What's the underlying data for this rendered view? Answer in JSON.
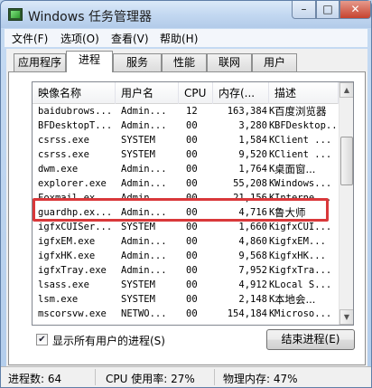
{
  "window": {
    "title": "Windows 任务管理器",
    "controls": {
      "minimize": "–",
      "maximize": "□",
      "close": "✕"
    }
  },
  "menu": [
    "文件(F)",
    "选项(O)",
    "查看(V)",
    "帮助(H)"
  ],
  "tabs": [
    "应用程序",
    "进程",
    "服务",
    "性能",
    "联网",
    "用户"
  ],
  "active_tab": "进程",
  "columns": [
    "映像名称",
    "用户名",
    "CPU",
    "内存(...",
    "描述"
  ],
  "processes": [
    {
      "name": "baidubrows...",
      "user": "Admin...",
      "cpu": "12",
      "mem": "163,384",
      "unit": "K",
      "desc": "百度浏览器"
    },
    {
      "name": "BFDesktopT...",
      "user": "Admin...",
      "cpu": "00",
      "mem": "3,280",
      "unit": "K",
      "desc": "BFDesktop..."
    },
    {
      "name": "csrss.exe",
      "user": "SYSTEM",
      "cpu": "00",
      "mem": "1,584",
      "unit": "K",
      "desc": "Client ..."
    },
    {
      "name": "csrss.exe",
      "user": "SYSTEM",
      "cpu": "00",
      "mem": "9,520",
      "unit": "K",
      "desc": "Client ..."
    },
    {
      "name": "dwm.exe",
      "user": "Admin...",
      "cpu": "00",
      "mem": "1,764",
      "unit": "K",
      "desc": "桌面窗..."
    },
    {
      "name": "explorer.exe",
      "user": "Admin...",
      "cpu": "00",
      "mem": "55,208",
      "unit": "K",
      "desc": "Windows..."
    },
    {
      "name": "Foxmail.ex...",
      "user": "Admin...",
      "cpu": "00",
      "mem": "21,156",
      "unit": "K",
      "desc": "Interne..."
    },
    {
      "name": "guardhp.ex...",
      "user": "Admin...",
      "cpu": "00",
      "mem": "4,716",
      "unit": "K",
      "desc": "鲁大师"
    },
    {
      "name": "igfxCUISer...",
      "user": "SYSTEM",
      "cpu": "00",
      "mem": "1,660",
      "unit": "K",
      "desc": "igfxCUI..."
    },
    {
      "name": "igfxEM.exe",
      "user": "Admin...",
      "cpu": "00",
      "mem": "4,860",
      "unit": "K",
      "desc": "igfxEM..."
    },
    {
      "name": "igfxHK.exe",
      "user": "Admin...",
      "cpu": "00",
      "mem": "9,568",
      "unit": "K",
      "desc": "igfxHK..."
    },
    {
      "name": "igfxTray.exe",
      "user": "Admin...",
      "cpu": "00",
      "mem": "7,952",
      "unit": "K",
      "desc": "igfxTra..."
    },
    {
      "name": "lsass.exe",
      "user": "SYSTEM",
      "cpu": "00",
      "mem": "4,912",
      "unit": "K",
      "desc": "Local S..."
    },
    {
      "name": "lsm.exe",
      "user": "SYSTEM",
      "cpu": "00",
      "mem": "2,148",
      "unit": "K",
      "desc": "本地会..."
    },
    {
      "name": "mscorsvw.exe",
      "user": "NETWO...",
      "cpu": "00",
      "mem": "154,184",
      "unit": "K",
      "desc": "Microso..."
    }
  ],
  "highlighted_process": "explorer.exe",
  "show_all_users": {
    "checked": true,
    "label": "显示所有用户的进程(S)"
  },
  "end_process_button": "结束进程(E)",
  "status": {
    "processes": "进程数: 64",
    "cpu": "CPU 使用率: 27%",
    "memory": "物理内存: 47%"
  },
  "colors": {
    "highlight_border": "#d9383a",
    "title_gradient_top": "#dbe9f8"
  }
}
